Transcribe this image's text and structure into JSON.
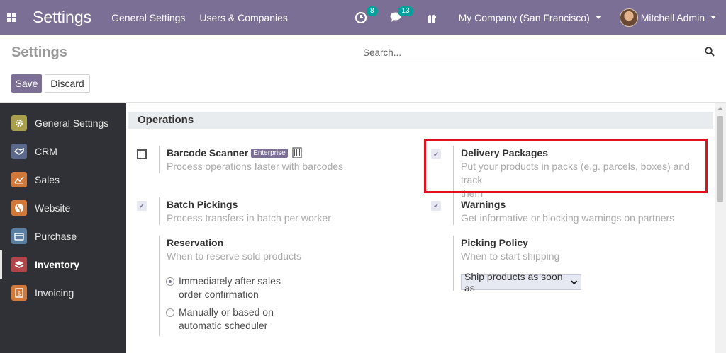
{
  "navbar": {
    "brand": "Settings",
    "menu": [
      "General Settings",
      "Users & Companies"
    ],
    "activities_count": "8",
    "messages_count": "13",
    "company": "My Company (San Francisco)",
    "user": "Mitchell Admin",
    "bg_color": "#7c6f95",
    "badge_color": "#00a09d"
  },
  "control_panel": {
    "title": "Settings",
    "search_placeholder": "Search...",
    "save_label": "Save",
    "discard_label": "Discard"
  },
  "sidebar": {
    "items": [
      {
        "label": "General Settings",
        "icon": "gear-icon",
        "color": "#a89e4b"
      },
      {
        "label": "CRM",
        "icon": "crm-icon",
        "color": "#5b6a8a"
      },
      {
        "label": "Sales",
        "icon": "sales-icon",
        "color": "#d2793a"
      },
      {
        "label": "Website",
        "icon": "website-icon",
        "color": "#d2793a"
      },
      {
        "label": "Purchase",
        "icon": "purchase-icon",
        "color": "#5b7fa3"
      },
      {
        "label": "Inventory",
        "icon": "inventory-icon",
        "color": "#b3454a"
      },
      {
        "label": "Invoicing",
        "icon": "invoicing-icon",
        "color": "#d2793a"
      }
    ],
    "active": "Inventory"
  },
  "section": {
    "title": "Operations",
    "barcode": {
      "title": "Barcode Scanner",
      "badge": "Enterprise",
      "desc": "Process operations faster with barcodes",
      "checked": false
    },
    "delivery": {
      "title": "Delivery Packages",
      "desc_line1": "Put your products in packs (e.g. parcels, boxes) and track",
      "desc_line2": "them",
      "checked": true
    },
    "batch": {
      "title": "Batch Pickings",
      "desc": "Process transfers in batch per worker",
      "checked": true
    },
    "warnings": {
      "title": "Warnings",
      "desc": "Get informative or blocking warnings on partners",
      "checked": true
    },
    "reservation": {
      "title": "Reservation",
      "desc": "When to reserve sold products",
      "options": [
        {
          "line1": "Immediately after sales",
          "line2": "order confirmation",
          "selected": true
        },
        {
          "line1": "Manually or based on",
          "line2": "automatic scheduler",
          "selected": false
        }
      ]
    },
    "picking_policy": {
      "title": "Picking Policy",
      "desc": "When to start shipping",
      "value": "Ship products as soon as"
    }
  }
}
